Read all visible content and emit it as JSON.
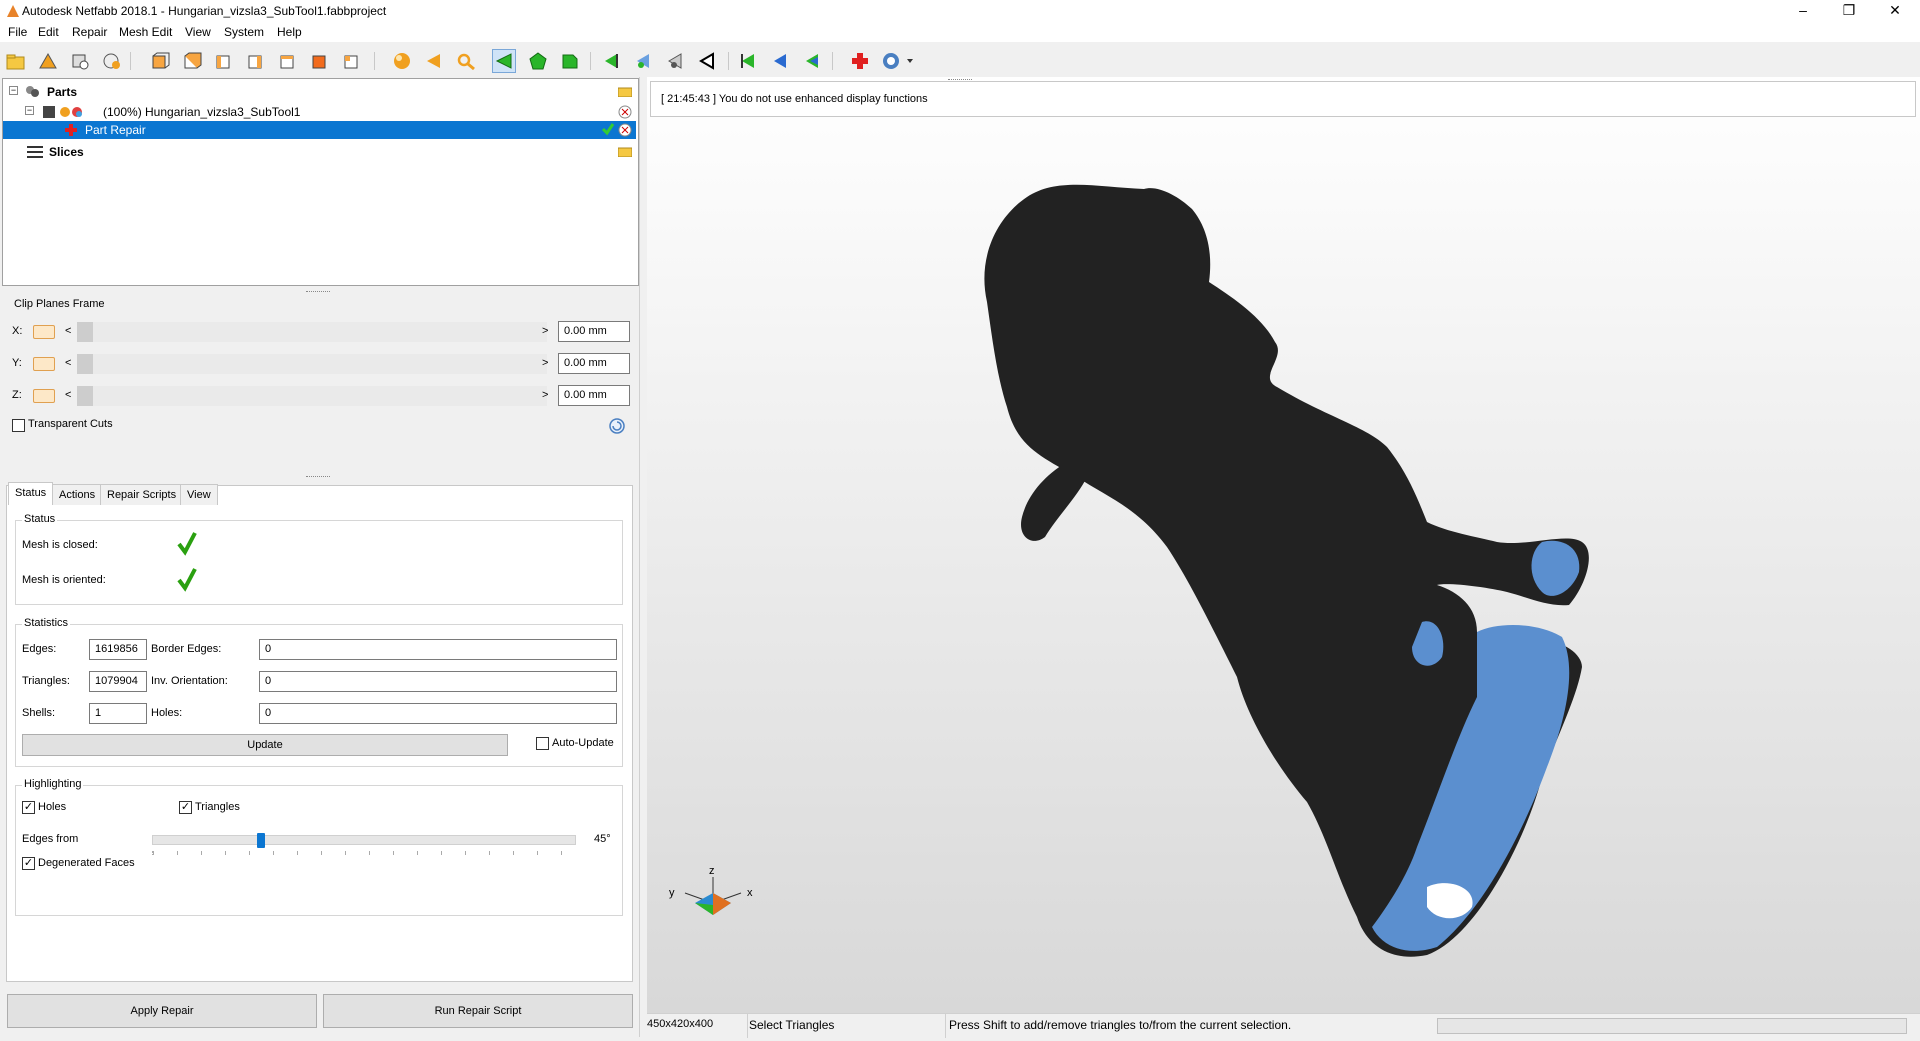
{
  "window": {
    "title": "Autodesk Netfabb 2018.1 - Hungarian_vizsla3_SubTool1.fabbproject",
    "controls": [
      "–",
      "❐",
      "✕"
    ]
  },
  "menu": [
    "File",
    "Edit",
    "Repair",
    "Mesh Edit",
    "View",
    "System",
    "Help"
  ],
  "toolbar": {
    "icons": [
      "open-icon",
      "add-part-icon",
      "add-tool-icon",
      "add-circle-icon",
      "view-front-icon",
      "view-back-icon",
      "view-left-icon",
      "view-right-icon",
      "view-top-icon",
      "view-bottom-icon",
      "view-iso-icon",
      "sphere-icon",
      "arrow-left-icon",
      "zoom-icon",
      "select-triangle-icon",
      "select-surface-icon",
      "select-shell-icon",
      "cut-icon",
      "scale-icon",
      "move-icon",
      "align-icon",
      "prev-icon",
      "next-icon",
      "back-icon",
      "repair-cross-icon",
      "help-icon"
    ]
  },
  "tree": {
    "parts_label": "Parts",
    "part_name": "(100%) Hungarian_vizsla3_SubTool1",
    "repair_label": "Part Repair",
    "slices_label": "Slices"
  },
  "clip": {
    "title": "Clip Planes Frame",
    "axes": [
      {
        "label": "X:",
        "value": "0.00 mm"
      },
      {
        "label": "Y:",
        "value": "0.00 mm"
      },
      {
        "label": "Z:",
        "value": "0.00 mm"
      }
    ],
    "transparent_label": "Transparent Cuts"
  },
  "tabs": [
    "Status",
    "Actions",
    "Repair Scripts",
    "View"
  ],
  "status": {
    "title": "Status",
    "closed_label": "Mesh is closed:",
    "oriented_label": "Mesh is oriented:"
  },
  "statistics": {
    "title": "Statistics",
    "edges_label": "Edges:",
    "edges": "1619856",
    "border_label": "Border Edges:",
    "border": "0",
    "triangles_label": "Triangles:",
    "triangles": "1079904",
    "inv_label": "Inv. Orientation:",
    "inv": "0",
    "shells_label": "Shells:",
    "shells": "1",
    "holes_label": "Holes:",
    "holes": "0",
    "update_label": "Update",
    "auto_update_label": "Auto-Update"
  },
  "highlighting": {
    "title": "Highlighting",
    "holes_label": "Holes",
    "triangles_label": "Triangles",
    "edges_from_label": "Edges from",
    "edges_from_value": "45°",
    "slider_fraction": 0.25,
    "degenerated_label": "Degenerated Faces"
  },
  "buttons": {
    "apply": "Apply Repair",
    "run_script": "Run Repair Script"
  },
  "viewport": {
    "message": "[ 21:45:43 ] You do not use enhanced display functions",
    "axis_z": "z",
    "axis_y": "y",
    "axis_x": "x"
  },
  "statusbar": {
    "dims": "450x420x400",
    "mode": "Select Triangles",
    "hint": "Press Shift to add/remove triangles to/from the current selection."
  },
  "colors": {
    "selection": "#0b76d1",
    "mesh": "#222222",
    "mesh_highlight": "#5b8fcf",
    "check": "#2aa010"
  }
}
